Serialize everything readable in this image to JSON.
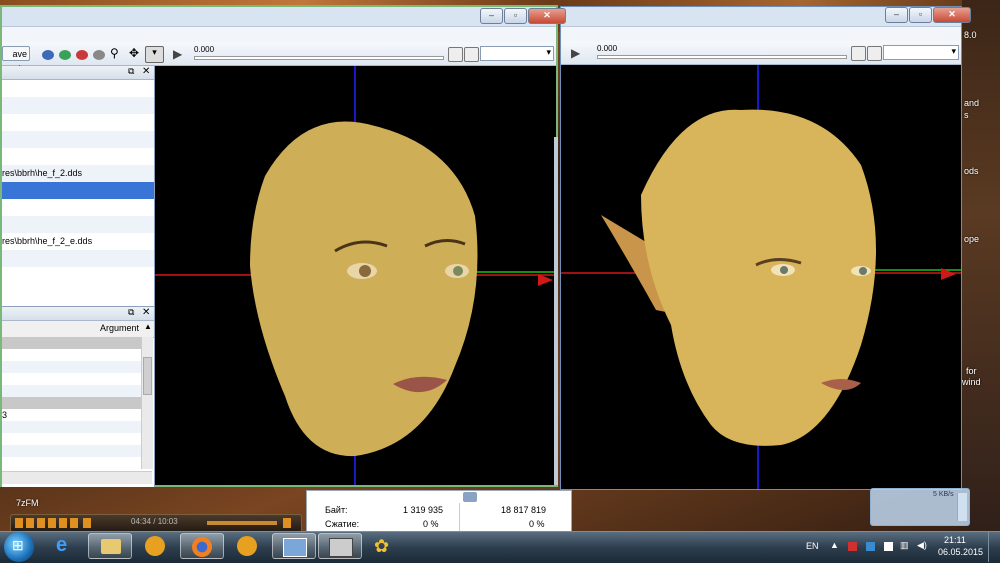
{
  "left_window": {
    "toolbar": {
      "save_as_label": "ave As",
      "time_value": "0.000"
    },
    "tree_panel": {
      "rows": [
        "",
        "",
        "",
        "",
        "",
        "res\\bbrh\\he_f_2.dds",
        "",
        "",
        "",
        "res\\bbrh\\he_f_2_e.dds",
        "",
        ""
      ],
      "selected_index": 6
    },
    "bottom_panel": {
      "column_header": "Argument",
      "rows": [
        "",
        "",
        "",
        "",
        "",
        "",
        "3",
        "",
        "",
        ""
      ]
    }
  },
  "right_window": {
    "toolbar": {
      "time_value": "0.000"
    }
  },
  "desktop": {
    "icon_texts": [
      "8.0",
      "and",
      "s",
      "ods",
      "ope",
      "for",
      "wind",
      "7zFM"
    ],
    "speed_widget": "5 KB/s"
  },
  "media_player": {
    "time_display": "04:34 / 10:03"
  },
  "stats": {
    "bytes_label": "Байт:",
    "bytes_value_1": "1 319 935",
    "bytes_value_2": "18 817 819",
    "compress_label": "Сжатие:",
    "compress_value_1": "0 %",
    "compress_value_2": "0 %"
  },
  "taskbar": {
    "language": "EN",
    "time": "21:11",
    "date": "06.05.2015"
  },
  "colors": {
    "axis_red": "#d01818",
    "axis_green": "#18c018",
    "axis_blue": "#1818c8",
    "skin": "#d8b45a",
    "selection": "#3875d7"
  }
}
